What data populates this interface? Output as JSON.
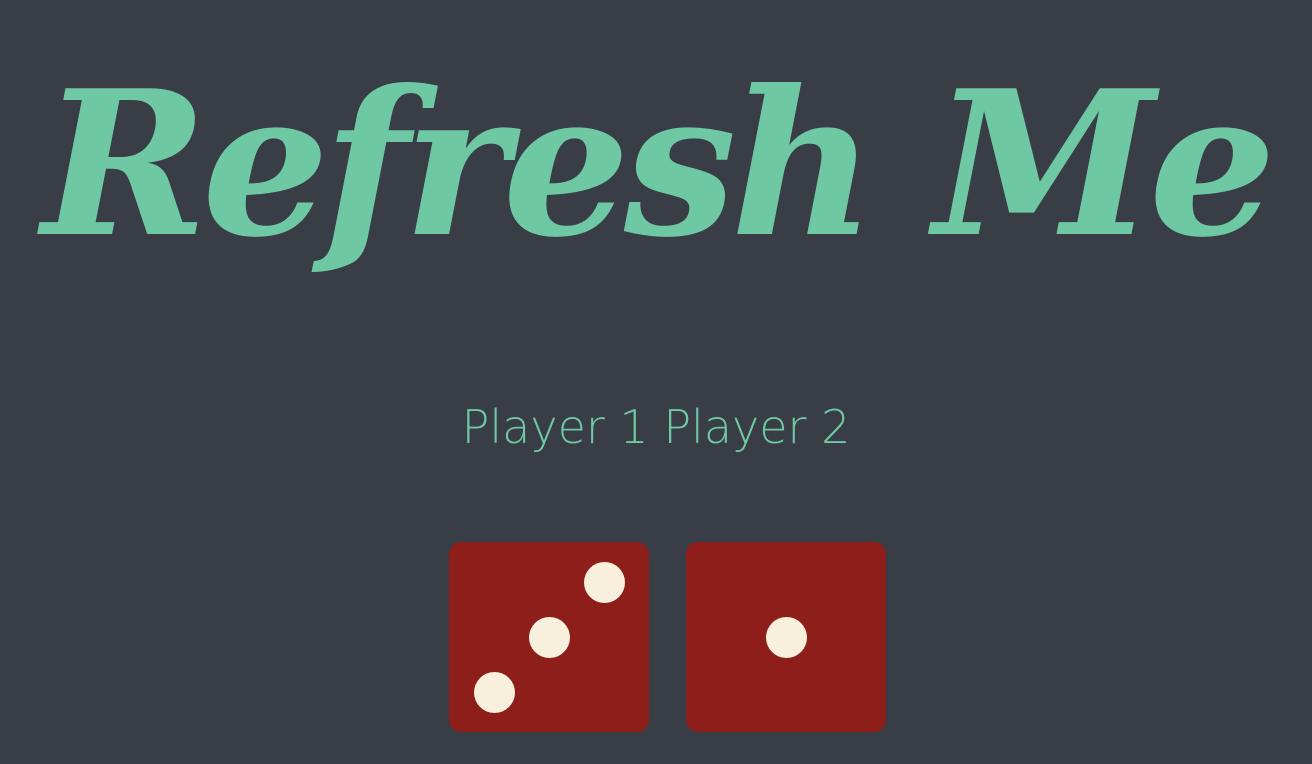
{
  "title": "Refresh Me",
  "players": {
    "player1": "Player 1",
    "player2": "Player 2"
  },
  "dice": [
    {
      "name": "player-1-die",
      "value": 3
    },
    {
      "name": "player-2-die",
      "value": 1
    }
  ],
  "colors": {
    "background": "#393e46",
    "accent": "#6fc8a4",
    "die": "#8d1e1a",
    "pip": "#f8f0dc"
  }
}
